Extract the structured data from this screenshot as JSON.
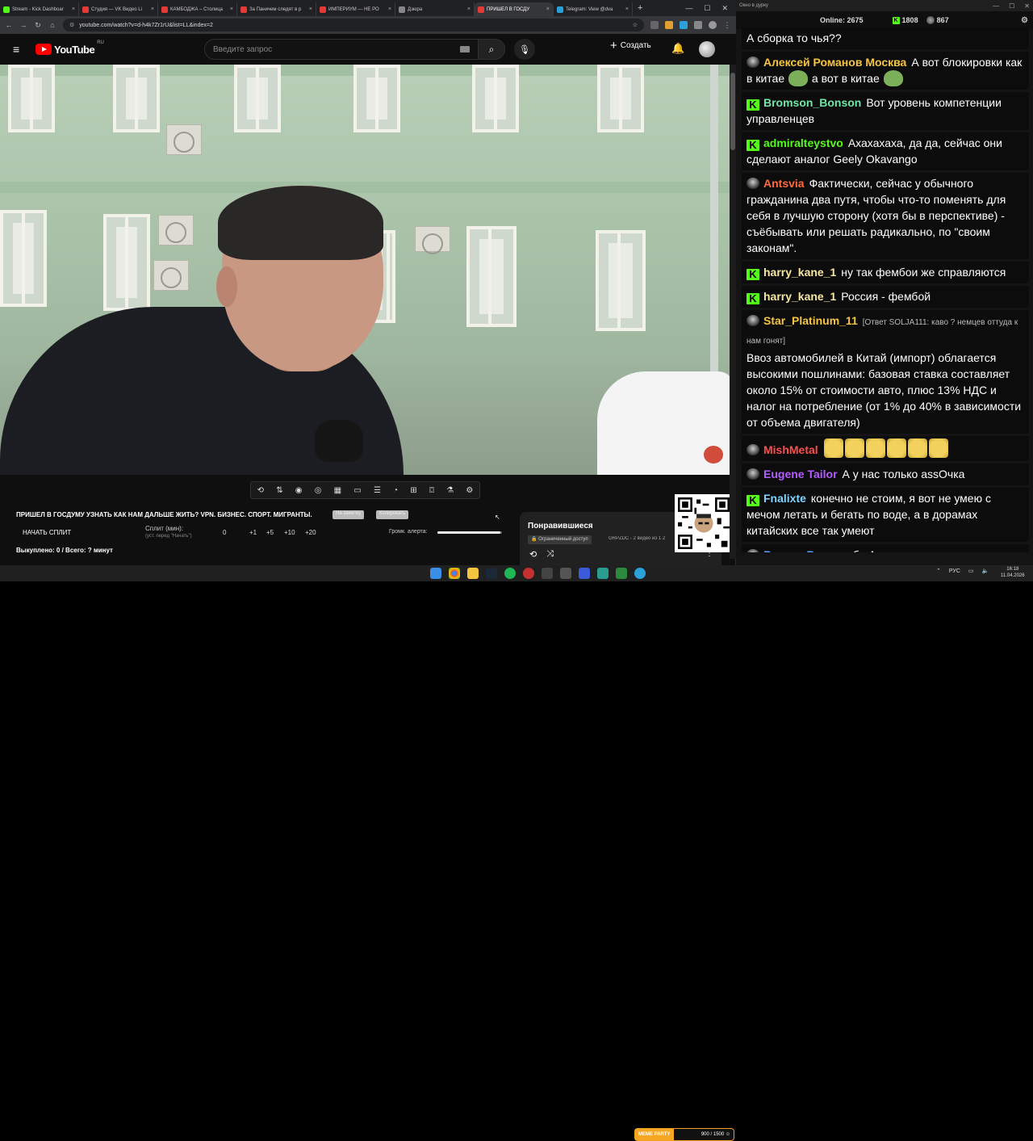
{
  "browser": {
    "tabs": [
      {
        "title": "Stream - Kick Dashboar",
        "color": "#53fc18",
        "active": false
      },
      {
        "title": "Студия — VK Видео Li",
        "color": "#e53935",
        "active": false
      },
      {
        "title": "КАМБОДЖА – Столица",
        "color": "#e53935",
        "active": false
      },
      {
        "title": "За Паничем следят в р",
        "color": "#e53935",
        "active": false
      },
      {
        "title": "ИМПЕРИУМ — НЕ РО",
        "color": "#e53935",
        "active": false
      },
      {
        "title": "Дзюра",
        "color": "#888888",
        "active": false
      },
      {
        "title": "ПРИШЕЛ В ГОСДУ",
        "color": "#e53935",
        "active": true
      },
      {
        "title": "Telegram: View @dva",
        "color": "#2aa1da",
        "active": false
      }
    ],
    "url": "youtube.com/watch?v=d-h4k7Zr1rU&list=LL&index=2",
    "new_tab": "+",
    "min": "—",
    "max": "☐",
    "close": "✕"
  },
  "youtube": {
    "logo_text": "YouTube",
    "region": "RU",
    "search_placeholder": "Введите запрос",
    "create_label": "Создать"
  },
  "video": {
    "title": "ПРИШЕЛ В ГОСДУМУ УЗНАТЬ КАК НАМ ДАЛЬШЕ ЖИТЬ? VPN. БИЗНЕС. СПОРТ. МИГРАНТЫ.",
    "pill1": "На заметку",
    "pill2": "Копировать"
  },
  "split": {
    "start": "НАЧАТЬ СПЛИТ",
    "label": "Сплит (мин):",
    "hint": "(уст. перед \"Начать\")",
    "value": "0",
    "steps": [
      "+1",
      "+5",
      "+10",
      "+20"
    ],
    "alert_label": "Громк. алерта:",
    "alert_level": 0.98,
    "bought": "Выкуплено: 0 / Всего: ? минут"
  },
  "playlist": {
    "title": "Понравившиеся",
    "access": "Ограниченный доступ",
    "sub": "GRPZDC - 2 видео из 1 2"
  },
  "chat": {
    "window_title": "Окно в дурку",
    "online_label": "Online:",
    "online": "2675",
    "kick_count": "1808",
    "twitch_count": "867",
    "messages": [
      {
        "src": "none",
        "nick": "",
        "color": "#ffffff",
        "text": "А сборка то чья??"
      },
      {
        "src": "twitch",
        "nick": "Алексей Романов Москва",
        "color": "#f5c542",
        "text": "А вот блокировки как в китае",
        "emote1": true,
        "text2": "а вот в китае",
        "emote2": true
      },
      {
        "src": "kick",
        "nick": "Bromson_Bonson",
        "color": "#6ee7a8",
        "text": "Вот уровень компетенции управленцев"
      },
      {
        "src": "kick",
        "nick": "admiralteystvo",
        "color": "#53fc18",
        "text": "Ахахахаха, да да, сейчас они сделают аналог Geely Okavango"
      },
      {
        "src": "twitch",
        "nick": "Antsvia",
        "color": "#ff6b3d",
        "text": "Фактически, сейчас у обычного гражданина два путя, чтобы что-то поменять для себя в лучшую сторону (хотя бы в перспективе) - съёбывать или решать радикально, по \"своим законам\"."
      },
      {
        "src": "kick",
        "nick": "harry_kane_1",
        "color": "#f5e6a0",
        "text": "ну так фембои же справляются"
      },
      {
        "src": "kick",
        "nick": "harry_kane_1",
        "color": "#f5e6a0",
        "text": "Россия - фембой"
      },
      {
        "src": "twitch",
        "nick": "Star_Platinum_11",
        "color": "#f5c542",
        "reply": "[Ответ SOLJA111: каво ? немцев оттуда к нам гонят]",
        "text": "Ввоз автомобилей в Китай (импорт) облагается высокими пошлинами: базовая ставка составляет около 15% от стоимости авто, плюс 13% НДС и налог на потребление (от 1% до 40% в зависимости от объема двигателя)"
      },
      {
        "src": "twitch",
        "nick": "MishMetal",
        "color": "#ff4d4d",
        "text": "",
        "faces": 6
      },
      {
        "src": "twitch",
        "nick": "Eugene Tailor",
        "color": "#b45cff",
        "text": "А у нас только assОчка"
      },
      {
        "src": "kick",
        "nick": "Fnalixte",
        "color": "#7fd3ff",
        "text": "конечно не стоим, я вот не умею с мечом летать и бегать по воде, а в дорамах китайских все так умеют"
      },
      {
        "src": "twitch",
        "nick": "Виктор В.",
        "color": "#5b9bff",
        "text": "спасибо Амирану, что показал этих людей"
      }
    ]
  },
  "taskbar": {
    "meme_label": "MEME PARTY",
    "meme_count": "900 / 1500 ☺",
    "lang": "РУС",
    "time": "16:18",
    "date": "11.04.2026"
  }
}
